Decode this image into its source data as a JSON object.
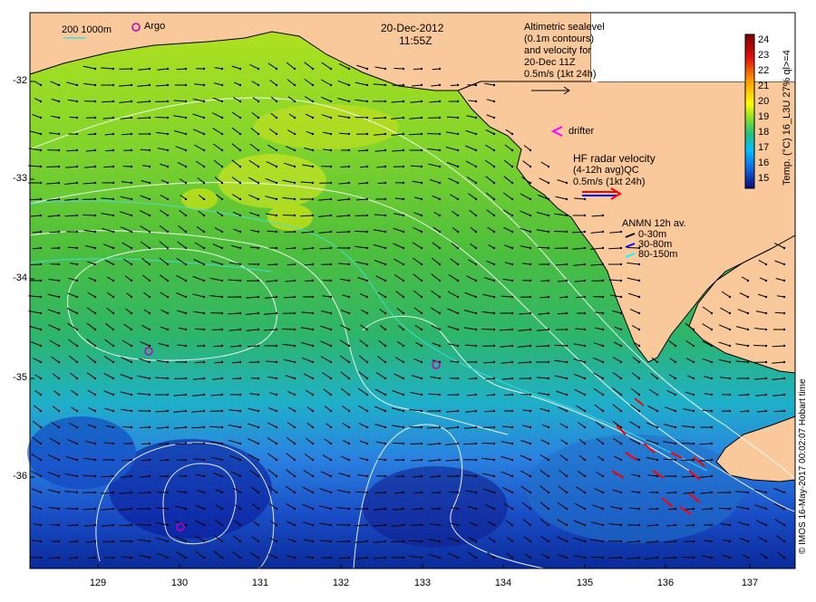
{
  "map": {
    "date": "20-Dec-2012",
    "time": "11:55Z",
    "y_ticks": [
      "-32",
      "-33",
      "-34",
      "-35",
      "-36"
    ],
    "x_ticks": [
      "129",
      "130",
      "131",
      "132",
      "133",
      "134",
      "135",
      "136",
      "137"
    ]
  },
  "legend_top_left": {
    "depth_label": "200  1000m",
    "argo_label": "Argo"
  },
  "altimetry_note": {
    "line1": "Altimetric sealevel",
    "line2": "(0.1m contours)",
    "line3": "and velocity for",
    "line4": "20-Dec 11Z",
    "line5": "0.5m/s (1kt 24h)"
  },
  "drifter_label": "drifter",
  "hf_radar": {
    "line1": "HF radar velocity",
    "line2": "(4-12h avg)QC",
    "line3": "0.5m/s (1kt 24h)"
  },
  "anmn": {
    "title": "ANMN 12h av.",
    "items": [
      {
        "label": "0-30m",
        "color": "#000000"
      },
      {
        "label": "30-80m",
        "color": "#0000ff"
      },
      {
        "label": "80-150m",
        "color": "#00ffff"
      }
    ]
  },
  "colorbar": {
    "title": "Temp. (°C) 16_L3U 27% ql>=4",
    "ticks": [
      "24",
      "23",
      "22",
      "21",
      "20",
      "19",
      "18",
      "17",
      "16",
      "15"
    ]
  },
  "copyright": "© IMOS 16-May-2017 00:02:07 Hobart time",
  "colors": {
    "land": "#f9c89b",
    "argo": "#c000c0",
    "hf_radar": "#ff0000",
    "contour": "#ffffff"
  }
}
